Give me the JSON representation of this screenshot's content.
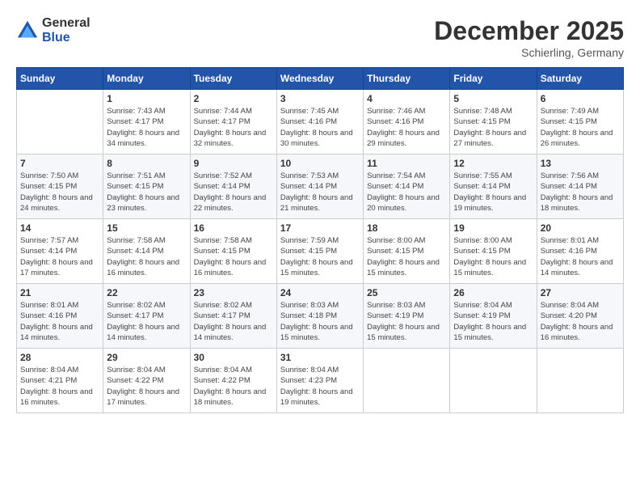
{
  "header": {
    "logo_general": "General",
    "logo_blue": "Blue",
    "month_title": "December 2025",
    "location": "Schierling, Germany"
  },
  "weekdays": [
    "Sunday",
    "Monday",
    "Tuesday",
    "Wednesday",
    "Thursday",
    "Friday",
    "Saturday"
  ],
  "weeks": [
    [
      {
        "day": "",
        "sunrise": "",
        "sunset": "",
        "daylight": ""
      },
      {
        "day": "1",
        "sunrise": "Sunrise: 7:43 AM",
        "sunset": "Sunset: 4:17 PM",
        "daylight": "Daylight: 8 hours and 34 minutes."
      },
      {
        "day": "2",
        "sunrise": "Sunrise: 7:44 AM",
        "sunset": "Sunset: 4:17 PM",
        "daylight": "Daylight: 8 hours and 32 minutes."
      },
      {
        "day": "3",
        "sunrise": "Sunrise: 7:45 AM",
        "sunset": "Sunset: 4:16 PM",
        "daylight": "Daylight: 8 hours and 30 minutes."
      },
      {
        "day": "4",
        "sunrise": "Sunrise: 7:46 AM",
        "sunset": "Sunset: 4:16 PM",
        "daylight": "Daylight: 8 hours and 29 minutes."
      },
      {
        "day": "5",
        "sunrise": "Sunrise: 7:48 AM",
        "sunset": "Sunset: 4:15 PM",
        "daylight": "Daylight: 8 hours and 27 minutes."
      },
      {
        "day": "6",
        "sunrise": "Sunrise: 7:49 AM",
        "sunset": "Sunset: 4:15 PM",
        "daylight": "Daylight: 8 hours and 26 minutes."
      }
    ],
    [
      {
        "day": "7",
        "sunrise": "Sunrise: 7:50 AM",
        "sunset": "Sunset: 4:15 PM",
        "daylight": "Daylight: 8 hours and 24 minutes."
      },
      {
        "day": "8",
        "sunrise": "Sunrise: 7:51 AM",
        "sunset": "Sunset: 4:15 PM",
        "daylight": "Daylight: 8 hours and 23 minutes."
      },
      {
        "day": "9",
        "sunrise": "Sunrise: 7:52 AM",
        "sunset": "Sunset: 4:14 PM",
        "daylight": "Daylight: 8 hours and 22 minutes."
      },
      {
        "day": "10",
        "sunrise": "Sunrise: 7:53 AM",
        "sunset": "Sunset: 4:14 PM",
        "daylight": "Daylight: 8 hours and 21 minutes."
      },
      {
        "day": "11",
        "sunrise": "Sunrise: 7:54 AM",
        "sunset": "Sunset: 4:14 PM",
        "daylight": "Daylight: 8 hours and 20 minutes."
      },
      {
        "day": "12",
        "sunrise": "Sunrise: 7:55 AM",
        "sunset": "Sunset: 4:14 PM",
        "daylight": "Daylight: 8 hours and 19 minutes."
      },
      {
        "day": "13",
        "sunrise": "Sunrise: 7:56 AM",
        "sunset": "Sunset: 4:14 PM",
        "daylight": "Daylight: 8 hours and 18 minutes."
      }
    ],
    [
      {
        "day": "14",
        "sunrise": "Sunrise: 7:57 AM",
        "sunset": "Sunset: 4:14 PM",
        "daylight": "Daylight: 8 hours and 17 minutes."
      },
      {
        "day": "15",
        "sunrise": "Sunrise: 7:58 AM",
        "sunset": "Sunset: 4:14 PM",
        "daylight": "Daylight: 8 hours and 16 minutes."
      },
      {
        "day": "16",
        "sunrise": "Sunrise: 7:58 AM",
        "sunset": "Sunset: 4:15 PM",
        "daylight": "Daylight: 8 hours and 16 minutes."
      },
      {
        "day": "17",
        "sunrise": "Sunrise: 7:59 AM",
        "sunset": "Sunset: 4:15 PM",
        "daylight": "Daylight: 8 hours and 15 minutes."
      },
      {
        "day": "18",
        "sunrise": "Sunrise: 8:00 AM",
        "sunset": "Sunset: 4:15 PM",
        "daylight": "Daylight: 8 hours and 15 minutes."
      },
      {
        "day": "19",
        "sunrise": "Sunrise: 8:00 AM",
        "sunset": "Sunset: 4:15 PM",
        "daylight": "Daylight: 8 hours and 15 minutes."
      },
      {
        "day": "20",
        "sunrise": "Sunrise: 8:01 AM",
        "sunset": "Sunset: 4:16 PM",
        "daylight": "Daylight: 8 hours and 14 minutes."
      }
    ],
    [
      {
        "day": "21",
        "sunrise": "Sunrise: 8:01 AM",
        "sunset": "Sunset: 4:16 PM",
        "daylight": "Daylight: 8 hours and 14 minutes."
      },
      {
        "day": "22",
        "sunrise": "Sunrise: 8:02 AM",
        "sunset": "Sunset: 4:17 PM",
        "daylight": "Daylight: 8 hours and 14 minutes."
      },
      {
        "day": "23",
        "sunrise": "Sunrise: 8:02 AM",
        "sunset": "Sunset: 4:17 PM",
        "daylight": "Daylight: 8 hours and 14 minutes."
      },
      {
        "day": "24",
        "sunrise": "Sunrise: 8:03 AM",
        "sunset": "Sunset: 4:18 PM",
        "daylight": "Daylight: 8 hours and 15 minutes."
      },
      {
        "day": "25",
        "sunrise": "Sunrise: 8:03 AM",
        "sunset": "Sunset: 4:19 PM",
        "daylight": "Daylight: 8 hours and 15 minutes."
      },
      {
        "day": "26",
        "sunrise": "Sunrise: 8:04 AM",
        "sunset": "Sunset: 4:19 PM",
        "daylight": "Daylight: 8 hours and 15 minutes."
      },
      {
        "day": "27",
        "sunrise": "Sunrise: 8:04 AM",
        "sunset": "Sunset: 4:20 PM",
        "daylight": "Daylight: 8 hours and 16 minutes."
      }
    ],
    [
      {
        "day": "28",
        "sunrise": "Sunrise: 8:04 AM",
        "sunset": "Sunset: 4:21 PM",
        "daylight": "Daylight: 8 hours and 16 minutes."
      },
      {
        "day": "29",
        "sunrise": "Sunrise: 8:04 AM",
        "sunset": "Sunset: 4:22 PM",
        "daylight": "Daylight: 8 hours and 17 minutes."
      },
      {
        "day": "30",
        "sunrise": "Sunrise: 8:04 AM",
        "sunset": "Sunset: 4:22 PM",
        "daylight": "Daylight: 8 hours and 18 minutes."
      },
      {
        "day": "31",
        "sunrise": "Sunrise: 8:04 AM",
        "sunset": "Sunset: 4:23 PM",
        "daylight": "Daylight: 8 hours and 19 minutes."
      },
      {
        "day": "",
        "sunrise": "",
        "sunset": "",
        "daylight": ""
      },
      {
        "day": "",
        "sunrise": "",
        "sunset": "",
        "daylight": ""
      },
      {
        "day": "",
        "sunrise": "",
        "sunset": "",
        "daylight": ""
      }
    ]
  ]
}
